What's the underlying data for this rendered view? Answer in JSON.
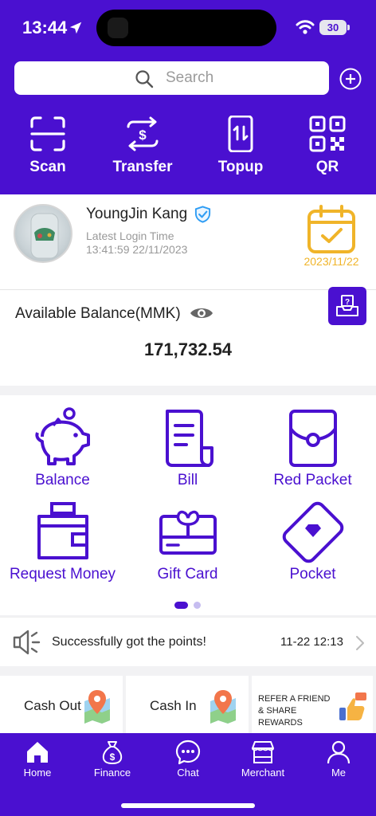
{
  "status_bar": {
    "time": "13:44",
    "battery": "30"
  },
  "search": {
    "placeholder": "Search"
  },
  "quick_actions": [
    {
      "label": "Scan",
      "icon": "scan-icon"
    },
    {
      "label": "Transfer",
      "icon": "transfer-icon"
    },
    {
      "label": "Topup",
      "icon": "topup-icon"
    },
    {
      "label": "QR",
      "icon": "qr-icon"
    }
  ],
  "profile": {
    "name": "YoungJin Kang",
    "login_label": "Latest Login Time",
    "login_time": "13:41:59 22/11/2023",
    "calendar_date": "2023/11/22"
  },
  "balance": {
    "label": "Available Balance(MMK)",
    "amount": "171,732.54"
  },
  "services": [
    {
      "label": "Balance",
      "icon": "piggy-bank-icon"
    },
    {
      "label": "Bill",
      "icon": "bill-icon"
    },
    {
      "label": "Red Packet",
      "icon": "red-packet-icon"
    },
    {
      "label": "Request Money",
      "icon": "wallet-icon"
    },
    {
      "label": "Gift Card",
      "icon": "gift-card-icon"
    },
    {
      "label": "Pocket",
      "icon": "pocket-icon"
    }
  ],
  "notice": {
    "text": "Successfully got the points!",
    "time": "11-22 12:13"
  },
  "promos": [
    {
      "label": "Cash Out",
      "icon": "map-pin-icon"
    },
    {
      "label": "Cash In",
      "icon": "map-pin-icon"
    },
    {
      "label": "REFER A FRIEND & SHARE REWARDS",
      "icon": "thumbs-up-icon"
    }
  ],
  "tabs": [
    {
      "label": "Home",
      "icon": "home-icon"
    },
    {
      "label": "Finance",
      "icon": "money-bag-icon"
    },
    {
      "label": "Chat",
      "icon": "chat-icon"
    },
    {
      "label": "Merchant",
      "icon": "store-icon"
    },
    {
      "label": "Me",
      "icon": "user-icon"
    }
  ],
  "colors": {
    "primary": "#4a10d0",
    "calendar": "#f0b429",
    "verified": "#2f9df4"
  }
}
